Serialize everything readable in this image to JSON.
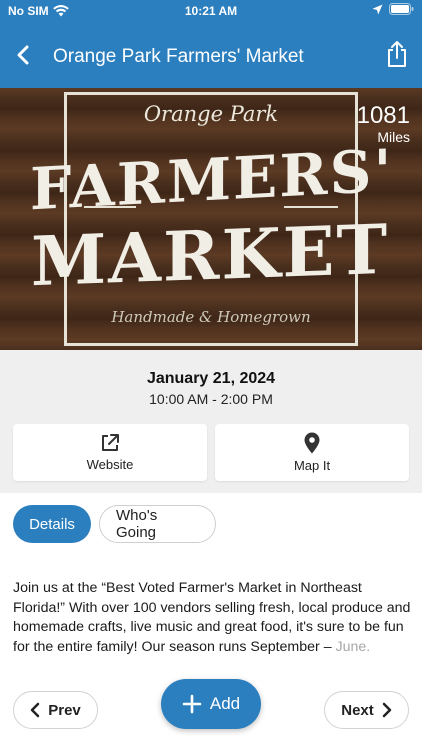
{
  "status_bar": {
    "carrier": "No SIM",
    "time": "10:21 AM"
  },
  "nav": {
    "title": "Orange Park Farmers' Market"
  },
  "hero": {
    "logo_top": "Orange Park",
    "logo_line1": "FARMERS'",
    "logo_line2": "MARKET",
    "logo_tagline": "Handmade & Homegrown",
    "distance_value": "1081",
    "distance_unit": "Miles"
  },
  "event": {
    "date": "January 21, 2024",
    "hours": "10:00 AM - 2:00 PM"
  },
  "actions": {
    "website_label": "Website",
    "map_label": "Map It"
  },
  "tabs": {
    "details": "Details",
    "whos_going": "Who's Going"
  },
  "description": {
    "text": "Join us at the “Best Voted Farmer's Market in Northeast Florida!” With over 100 vendors selling fresh, local produce and homemade crafts, live music and great food, it's sure to be fun for the entire family! Our season runs September –",
    "faded": "June."
  },
  "bottom": {
    "prev": "Prev",
    "add": "Add",
    "next": "Next"
  },
  "colors": {
    "accent": "#2c7fbf",
    "background": "#efefef"
  },
  "icons": {
    "back": "chevron-left-icon",
    "share": "share-icon",
    "website": "external-link-icon",
    "map": "map-pin-icon",
    "add": "plus-icon",
    "prev": "chevron-left-icon",
    "next": "chevron-right-icon"
  }
}
